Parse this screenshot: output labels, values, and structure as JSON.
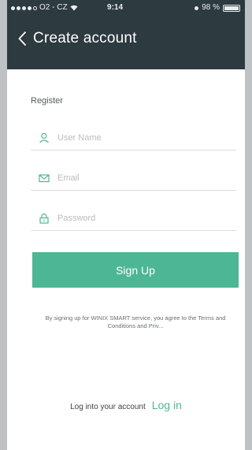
{
  "status_bar": {
    "carrier": "O2 - CZ",
    "time": "9:14",
    "battery": "98 %"
  },
  "header": {
    "title": "Create account"
  },
  "form": {
    "section_label": "Register",
    "username_placeholder": "User Name",
    "email_placeholder": "Email",
    "password_placeholder": "Password",
    "signup_label": "Sign Up",
    "terms_text": "By signing up for WINIX SMART service, you agree to the Terms and Conditions and Priv..."
  },
  "footer": {
    "login_prompt": "Log into your account",
    "login_link": "Log in"
  },
  "colors": {
    "accent": "#4db695",
    "header_bg": "#2d3a40"
  },
  "icons": {
    "back": "chevron-left-icon",
    "user": "user-icon",
    "email": "envelope-icon",
    "password": "lock-icon"
  }
}
